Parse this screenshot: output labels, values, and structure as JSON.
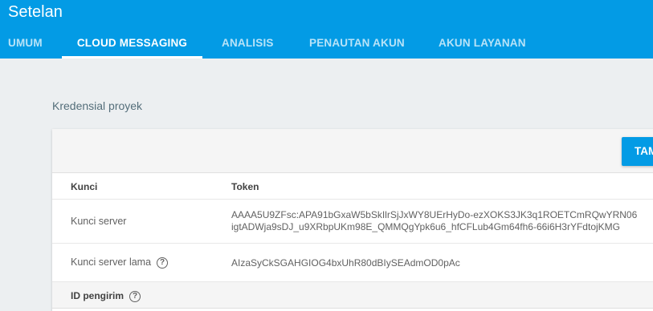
{
  "header": {
    "title": "Setelan",
    "tabs": [
      {
        "label": "UMUM"
      },
      {
        "label": "CLOUD MESSAGING"
      },
      {
        "label": "ANALISIS"
      },
      {
        "label": "PENAUTAN AKUN"
      },
      {
        "label": "AKUN LAYANAN"
      }
    ],
    "active_tab": "CLOUD MESSAGING"
  },
  "main": {
    "section_title": "Kredensial proyek",
    "add_button_label": "TAM",
    "table": {
      "columns": [
        "Kunci",
        "Token"
      ],
      "rows": [
        {
          "key": "Kunci server",
          "token_lines": [
            "AAAA5U9ZFsc:APA91bGxaW5bSkIlrSjJxWY8UErHyDo-ezXOKS3JK3q1ROETCmRQwYRN06",
            "igtADWja9sDJ_u9XRbpUKm98E_QMMQgYpk6u6_hfCFLub4Gm64fh6-66i6H3rYFdtojKMG"
          ]
        },
        {
          "key": "Kunci server lama",
          "token": "AIzaSyCkSGAHGIOG4bxUhR80dBIySEAdmOD0pAc",
          "help_icon": "help-icon"
        }
      ]
    },
    "sender_id_label": "ID pengirim",
    "help_glyph": "?"
  },
  "colors": {
    "primary": "#039be5",
    "background": "#eceff1"
  }
}
